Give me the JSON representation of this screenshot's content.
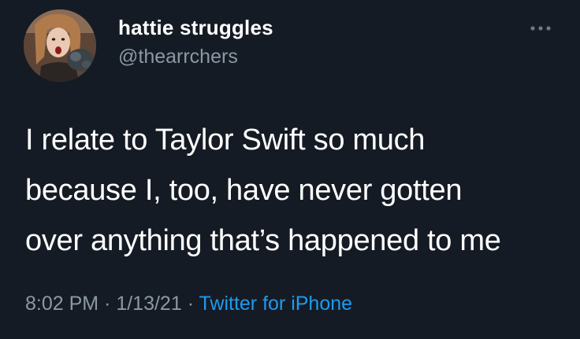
{
  "user": {
    "display_name": "hattie struggles",
    "handle": "@thearrchers",
    "avatar_icon": "profile-photo"
  },
  "menu": {
    "icon": "more-options-icon"
  },
  "tweet": {
    "lines": [
      "I relate to Taylor Swift so much",
      "because I, too, have never gotten",
      "over anything that’s happened to me"
    ]
  },
  "meta": {
    "time": "8:02 PM",
    "separator": " · ",
    "date": "1/13/21",
    "source": "Twitter for iPhone"
  },
  "colors": {
    "background": "#151b24",
    "text": "#ffffff",
    "secondary": "#8b98a5",
    "link": "#1d9bf0"
  }
}
